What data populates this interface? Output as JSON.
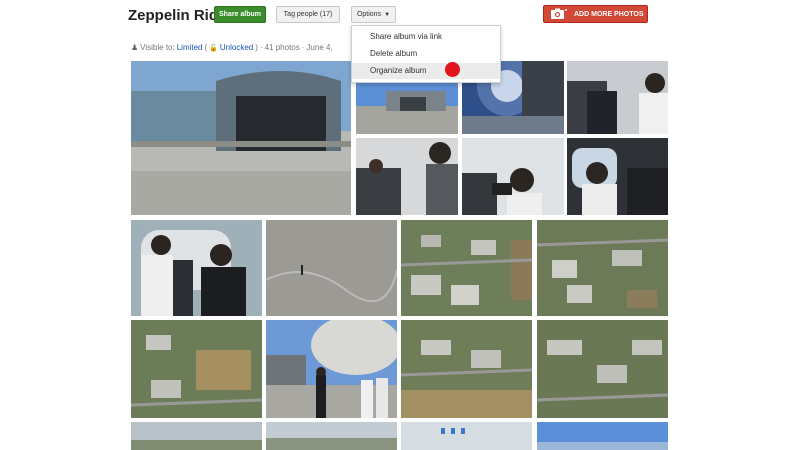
{
  "album": {
    "title": "Zeppelin Ride"
  },
  "toolbar": {
    "share_label": "Share album",
    "tag_label": "Tag people (17)",
    "options_label": "Options",
    "add_photos_label": "ADD MORE PHOTOS"
  },
  "meta": {
    "visible_prefix": "Visible to:",
    "visibility": "Limited",
    "lock_open": "(",
    "lock_state": "Unlocked",
    "lock_close": ")",
    "sep1": "·",
    "photo_count": "41 photos",
    "sep2": "·",
    "date": "June 4,"
  },
  "options_menu": {
    "items": [
      {
        "label": "Share album via link"
      },
      {
        "label": "Delete album"
      },
      {
        "label": "Organize album"
      }
    ]
  },
  "colors": {
    "share": "#3b8c2a",
    "add": "#d14836",
    "link": "#1a55b8",
    "highlight_dot": "#e0161b"
  }
}
